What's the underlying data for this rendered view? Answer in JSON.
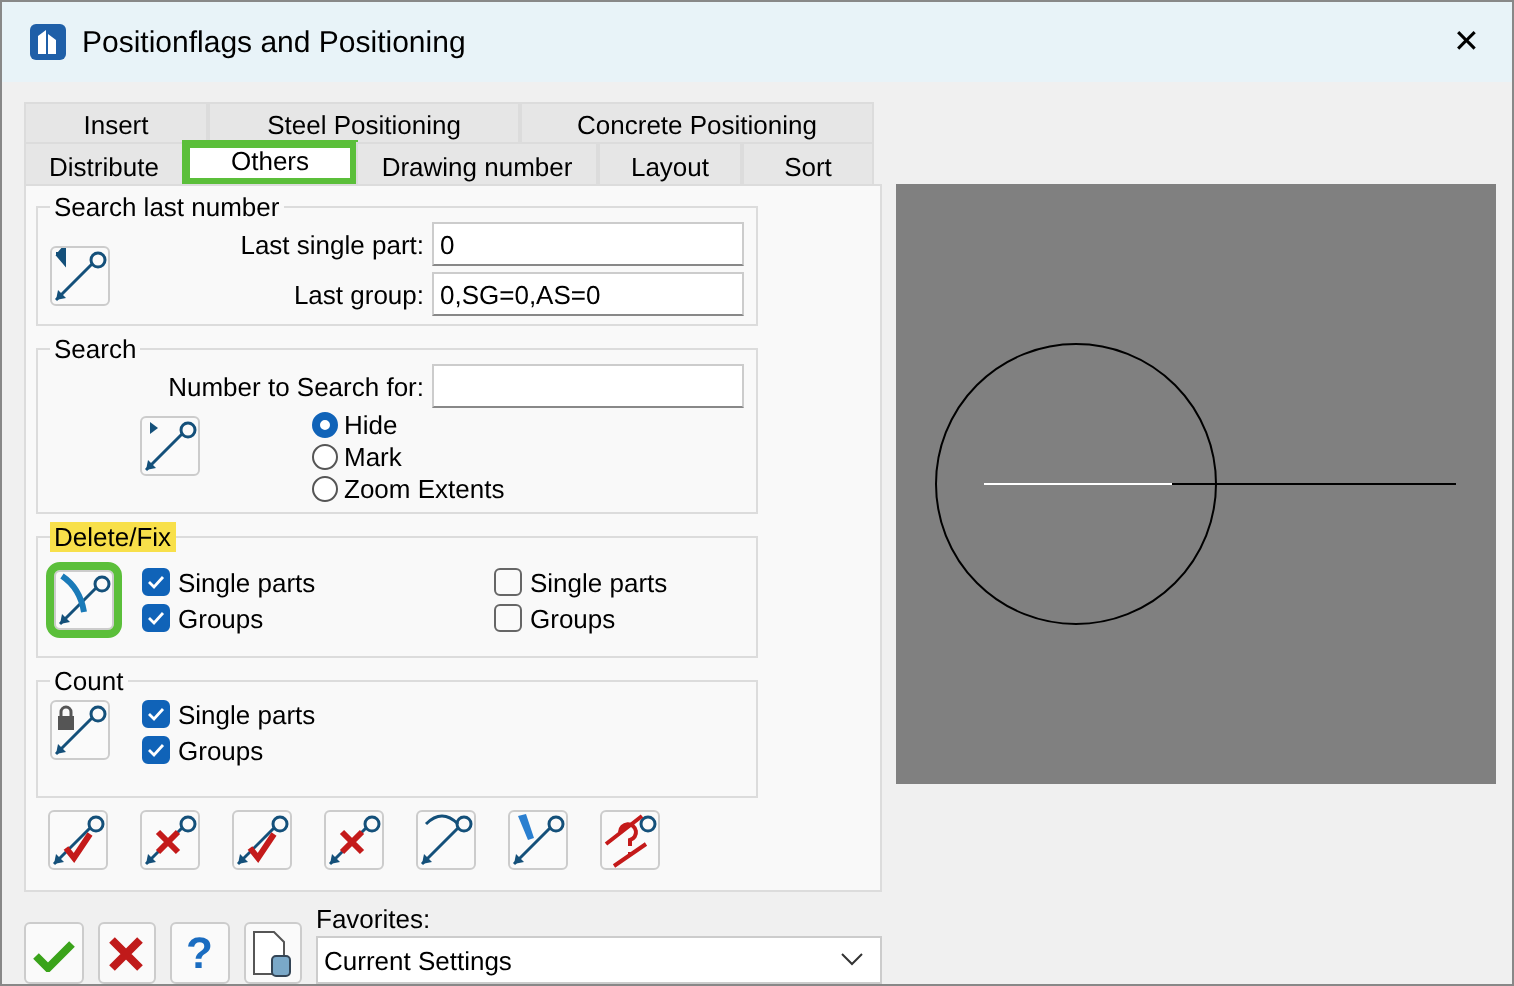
{
  "window": {
    "title": "Positionflags and Positioning",
    "close": "✕"
  },
  "tabs": [
    [
      {
        "label": "Insert",
        "selected": false,
        "highlighted": false
      },
      {
        "label": "Steel Positioning",
        "selected": false,
        "highlighted": false
      },
      {
        "label": "Concrete Positioning",
        "selected": false,
        "highlighted": false
      }
    ],
    [
      {
        "label": "Distribute",
        "selected": false,
        "highlighted": false
      },
      {
        "label": "Others",
        "selected": true,
        "highlighted": true
      },
      {
        "label": "Drawing number",
        "selected": false,
        "highlighted": false
      },
      {
        "label": "Layout",
        "selected": false,
        "highlighted": false
      },
      {
        "label": "Sort",
        "selected": false,
        "highlighted": false
      }
    ]
  ],
  "search_last_number": {
    "title": "Search last number",
    "fields": [
      {
        "label": "Last single part:",
        "value": "0"
      },
      {
        "label": "Last group:",
        "value": "0,SG=0,AS=0"
      }
    ]
  },
  "search": {
    "title": "Search",
    "field_label": "Number to Search for:",
    "options": [
      {
        "label": "Hide",
        "selected": true
      },
      {
        "label": "Mark",
        "selected": false
      },
      {
        "label": "Zoom Extents",
        "selected": false
      }
    ]
  },
  "delete_fix": {
    "title": "Delete/Fix",
    "highlighted": true,
    "icon_highlighted": true,
    "checkboxes": [
      {
        "label": "Single parts",
        "checked": true
      },
      {
        "label": "Groups",
        "checked": true
      },
      {
        "label": "Single parts",
        "checked": false
      },
      {
        "label": "Groups",
        "checked": false
      }
    ]
  },
  "count": {
    "title": "Count",
    "checkboxes": [
      {
        "label": "Single parts",
        "checked": true
      },
      {
        "label": "Groups",
        "checked": true
      }
    ]
  },
  "toolbar": [
    {
      "kind": "check"
    },
    {
      "kind": "cross"
    },
    {
      "kind": "checkline"
    },
    {
      "kind": "crossline"
    },
    {
      "kind": "arc"
    },
    {
      "kind": "pen"
    },
    {
      "kind": "question"
    }
  ],
  "help_button": "?",
  "favorites": {
    "label": "Favorites:",
    "value": "Current Settings"
  }
}
